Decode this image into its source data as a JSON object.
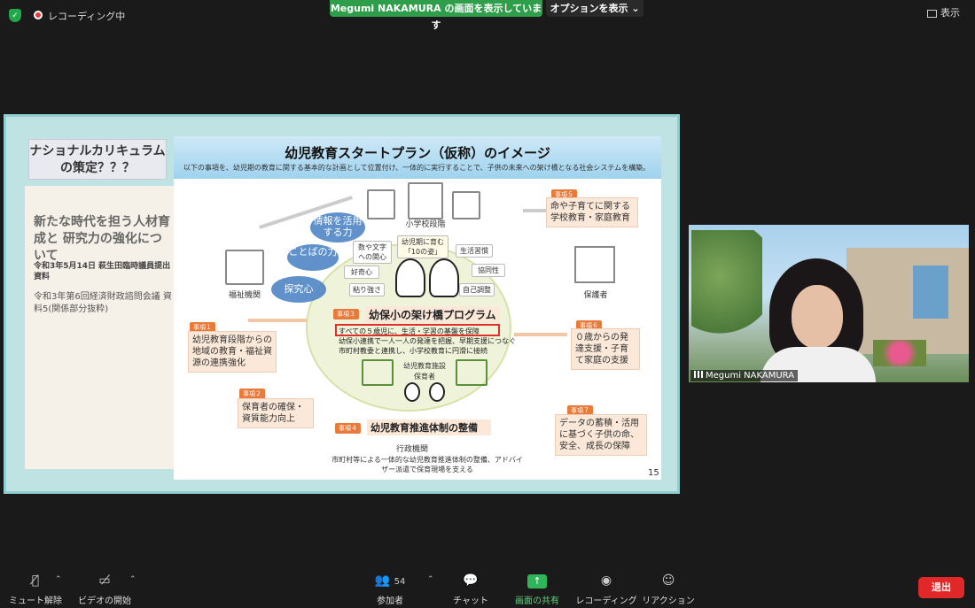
{
  "top": {
    "recording": "レコーディング中",
    "share_banner": "Megumi NAKAMURA の画面を表示しています",
    "options": "オプションを表示",
    "view": "表示"
  },
  "slide": {
    "left_title": "ナショナルカリキュラム\nの策定？？？",
    "left_heading": "新たな時代を担う人材育成と 研究力の強化について",
    "left_sub1": "令和3年5月14日 萩生田臨時議員提出資料",
    "left_sub2": "令和3年第6回経済財政諮問会議 資料5(関係部分抜粋)",
    "title": "幼児教育スタートプラン（仮称）のイメージ",
    "subtitle": "以下の事項を、幼児期の教育に関する基本的な計画として位置付け、一体的に実行することで、子供の未来への架け橋となる社会システムを構築。",
    "elementary": "小学校段階",
    "welfare": "福祉機関",
    "guardian": "保護者",
    "bubbles": [
      "情報を活用する力",
      "ことばの力",
      "探究心"
    ],
    "chips": [
      "数や文字への関心",
      "幼児期に育む「10の姿」",
      "生活習慣",
      "好奇心",
      "協同性",
      "粘り強さ",
      "自己調整"
    ],
    "item1_tag": "事項１",
    "item1": "幼児教育段階からの地域の教育・福祉資源の連携強化",
    "item2_tag": "事項２",
    "item2": "保育者の確保・資質能力向上",
    "item3_tag": "事項３",
    "item3_title": "幼保小の架け橋プログラム",
    "item3_b1": "すべての５歳児に、生活・学習の基盤を保障",
    "item3_b2": "幼保小連携で一人一人の発達を把握、早期支援につなぐ",
    "item3_b3": "市町村教委と連携し、小学校教育に円滑に接続",
    "facility": "幼児教育施設",
    "caregiver": "保育者",
    "item4_tag": "事項４",
    "item4": "幼児教育推進体制の整備",
    "admin": "行政機関",
    "item4_desc": "市町村等による一体的な幼児教育推進体制の整備、アドバイザー派遣で保育現場を支える",
    "item5_tag": "事項５",
    "item5": "命や子育てに関する学校教育・家庭教育",
    "item6_tag": "事項６",
    "item6": "０歳からの発達支援・子育て家庭の支援",
    "item7_tag": "事項７",
    "item7": "データの蓄積・活用に基づく子供の命、安全、成長の保障",
    "page": "15"
  },
  "video": {
    "name": "Megumi NAKAMURA"
  },
  "toolbar": {
    "mute": "ミュート解除",
    "video": "ビデオの開始",
    "participants": "参加者",
    "participants_count": "54",
    "chat": "チャット",
    "share": "画面の共有",
    "record": "レコーディング",
    "reaction": "リアクション",
    "leave": "退出"
  },
  "colors": {
    "share_green": "#2f9e4a",
    "leave_red": "#e02828",
    "slide_teal": "#bfe3e3",
    "bubble_blue": "#4f86c6",
    "item_orange": "#e87a3a"
  }
}
